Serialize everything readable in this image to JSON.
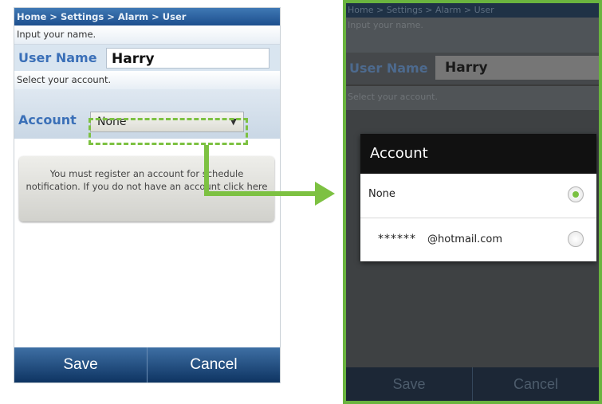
{
  "left_screen": {
    "breadcrumb": "Home > Settings > Alarm > User",
    "name_prompt": "Input your name.",
    "name_label": "User Name",
    "name_value": "Harry",
    "account_prompt": "Select your account.",
    "account_label": "Account",
    "account_selected": "None",
    "notice_text": "You must register an account for schedule notification. If you do not have an account click here",
    "save_label": "Save",
    "cancel_label": "Cancel"
  },
  "right_screen": {
    "breadcrumb": "Home > Settings > Alarm > User",
    "name_prompt": "Input your name.",
    "name_label": "User Name",
    "name_value": "Harry",
    "account_prompt": "Select your account.",
    "save_label": "Save",
    "cancel_label": "Cancel",
    "dialog": {
      "title": "Account",
      "options": [
        {
          "label": "None",
          "selected": true
        },
        {
          "stars": "******",
          "domain": "@hotmail.com",
          "selected": false
        }
      ]
    }
  },
  "colors": {
    "highlight_green": "#7dc142",
    "header_blue": "#1d4f8e",
    "label_blue": "#3b70b8"
  },
  "icons": {
    "dropdown": "chevron-down-icon",
    "connector": "arrow-right-icon",
    "radio": "radio-button-icon"
  }
}
